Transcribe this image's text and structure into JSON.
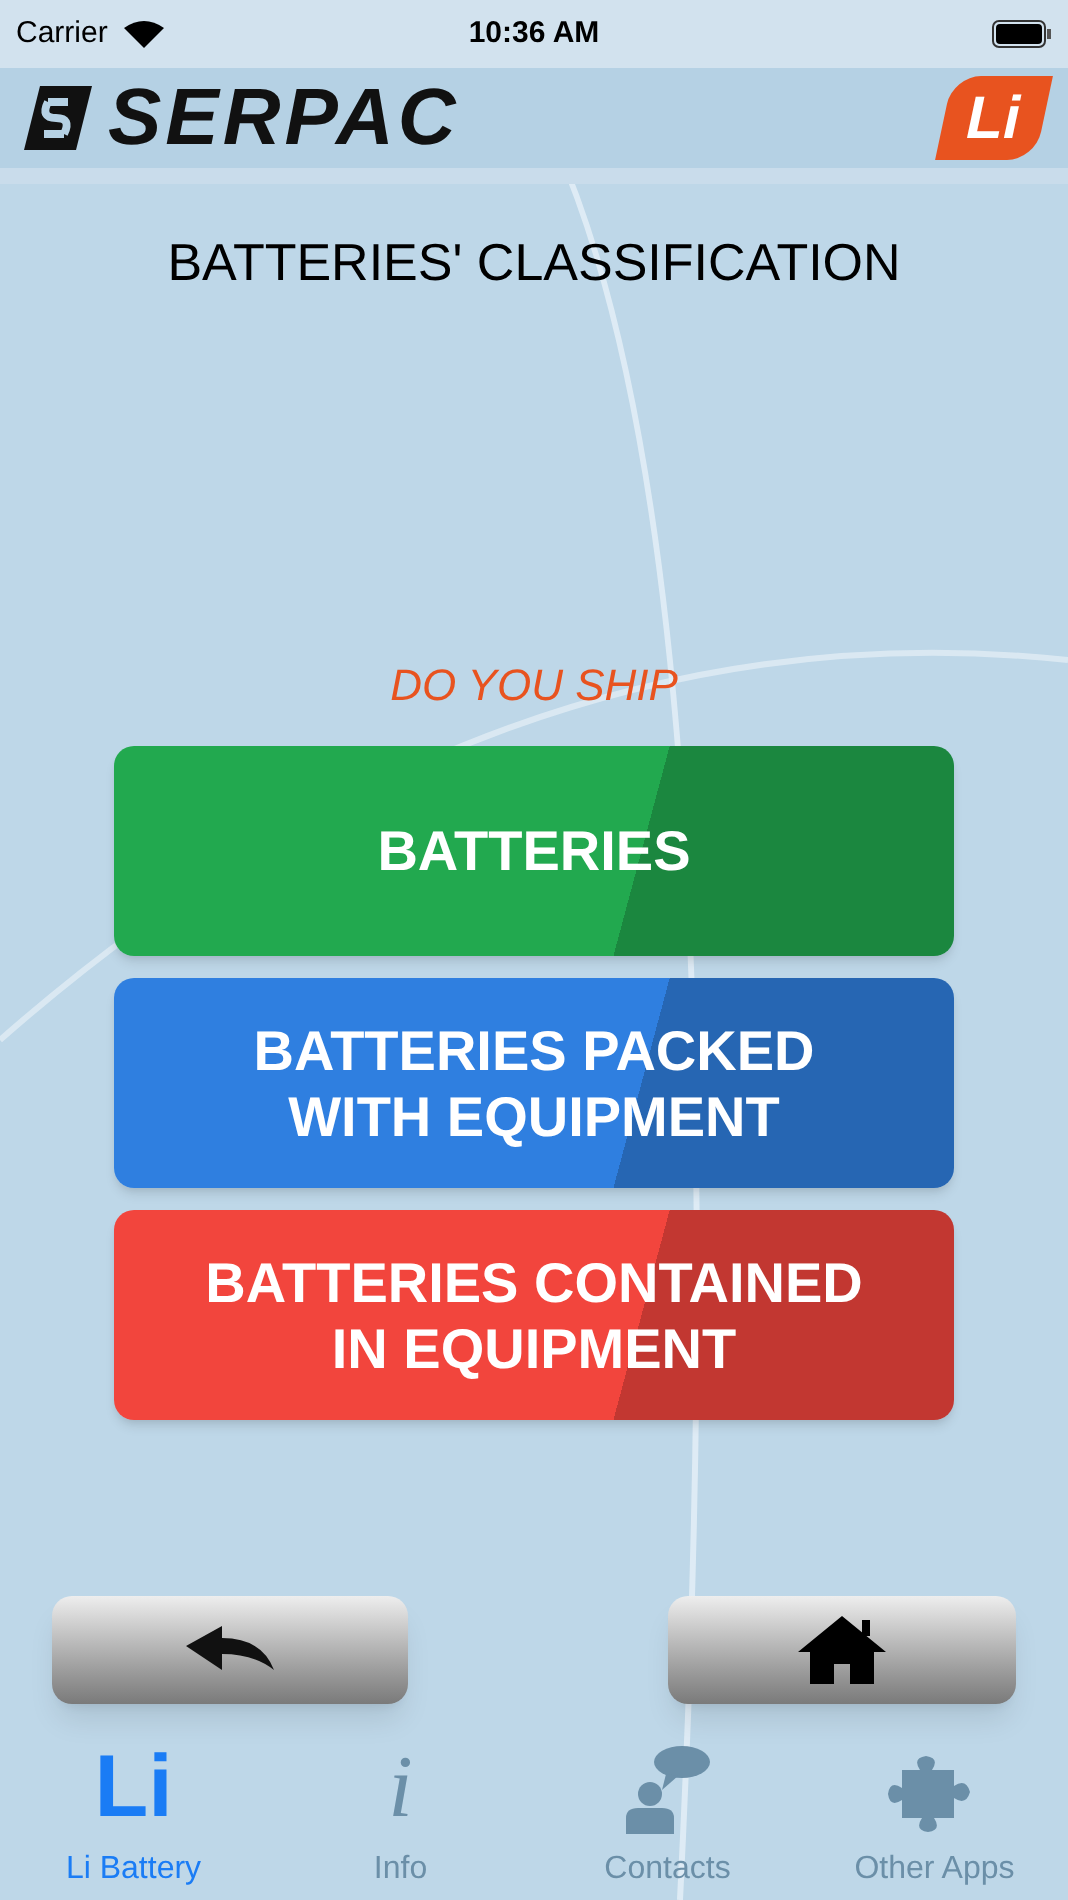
{
  "status_bar": {
    "carrier": "Carrier",
    "time": "10:36 AM"
  },
  "header": {
    "logo": "SERPAC",
    "badge": "Li"
  },
  "title": "BATTERIES' CLASSIFICATION",
  "question": "DO YOU SHIP",
  "options": [
    {
      "label": "BATTERIES",
      "color": "#22a94f"
    },
    {
      "label": "BATTERIES PACKED WITH EQUIPMENT",
      "color": "#2f7fe0"
    },
    {
      "label": "BATTERIES CONTAINED IN EQUIPMENT",
      "color": "#f2453d"
    }
  ],
  "tabs": [
    {
      "label": "Li Battery",
      "glyph": "Li",
      "kind": "glyph",
      "selected": true
    },
    {
      "label": "Info",
      "glyph": "i",
      "kind": "glyph",
      "selected": false
    },
    {
      "label": "Contacts",
      "kind": "person",
      "selected": false
    },
    {
      "label": "Other Apps",
      "kind": "puzzle",
      "selected": false
    }
  ]
}
